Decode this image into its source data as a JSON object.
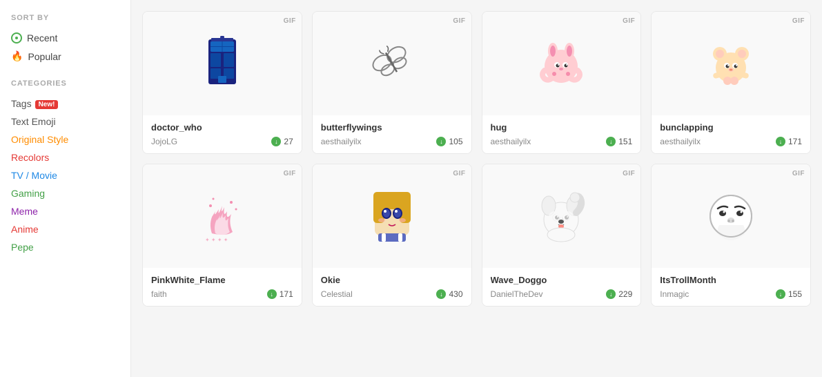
{
  "sidebar": {
    "sort_label": "SORT BY",
    "sort_items": [
      {
        "id": "recent",
        "label": "Recent",
        "icon": "clock-icon"
      },
      {
        "id": "popular",
        "label": "Popular",
        "icon": "fire-icon"
      }
    ],
    "categories_label": "CATEGORIES",
    "category_items": [
      {
        "id": "tags",
        "label": "Tags",
        "badge": "New!",
        "class": "cat-tags"
      },
      {
        "id": "text-emoji",
        "label": "Text Emoji",
        "class": "cat-text-emoji"
      },
      {
        "id": "original-style",
        "label": "Original Style",
        "class": "cat-original-style"
      },
      {
        "id": "recolors",
        "label": "Recolors",
        "class": "cat-recolors"
      },
      {
        "id": "tv-movie",
        "label": "TV / Movie",
        "class": "cat-tv-movie"
      },
      {
        "id": "gaming",
        "label": "Gaming",
        "class": "cat-gaming"
      },
      {
        "id": "meme",
        "label": "Meme",
        "class": "cat-meme"
      },
      {
        "id": "anime",
        "label": "Anime",
        "class": "cat-anime"
      },
      {
        "id": "pepe",
        "label": "Pepe",
        "class": "cat-pepe"
      }
    ]
  },
  "grid": {
    "badge_label": "GIF",
    "cards": [
      {
        "id": "doctor_who",
        "title": "doctor_who",
        "author": "JojoLG",
        "downloads": 27,
        "type": "gif",
        "preview": "tardis"
      },
      {
        "id": "butterflywings",
        "title": "butterflywings",
        "author": "aesthailyilx",
        "downloads": 105,
        "type": "gif",
        "preview": "butterfly"
      },
      {
        "id": "hug",
        "title": "hug",
        "author": "aesthailyilx",
        "downloads": 151,
        "type": "gif",
        "preview": "hug"
      },
      {
        "id": "bunclapping",
        "title": "bunclapping",
        "author": "aesthailyilx",
        "downloads": 171,
        "type": "gif",
        "preview": "bunclapping"
      },
      {
        "id": "pinkwhite_flame",
        "title": "PinkWhite_Flame",
        "author": "faith",
        "downloads": 171,
        "type": "gif",
        "preview": "pinkflame"
      },
      {
        "id": "okie",
        "title": "Okie",
        "author": "Celestial",
        "downloads": 430,
        "type": "gif",
        "preview": "okie"
      },
      {
        "id": "wave_doggo",
        "title": "Wave_Doggo",
        "author": "DanielTheDev",
        "downloads": 229,
        "type": "gif",
        "preview": "doggo"
      },
      {
        "id": "itstrollmonth",
        "title": "ItsTrollMonth",
        "author": "Inmagic",
        "downloads": 155,
        "type": "gif",
        "preview": "troll"
      }
    ]
  }
}
